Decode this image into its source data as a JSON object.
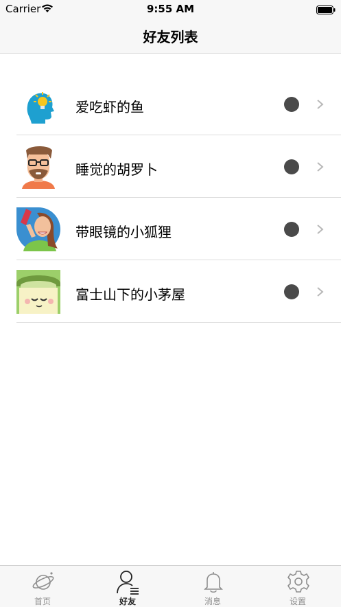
{
  "status_bar": {
    "carrier": "Carrier",
    "time": "9:55 AM"
  },
  "nav": {
    "title": "好友列表"
  },
  "friends": [
    {
      "name": "爱吃虾的鱼",
      "avatar": "lightbulb-head-avatar",
      "status_color": "#4a4a4a"
    },
    {
      "name": "睡觉的胡罗卜",
      "avatar": "bearded-man-avatar",
      "status_color": "#4a4a4a"
    },
    {
      "name": "带眼镜的小狐狸",
      "avatar": "selfie-woman-avatar",
      "status_color": "#4a4a4a"
    },
    {
      "name": "富士山下的小茅屋",
      "avatar": "capped-boy-avatar",
      "status_color": "#4a4a4a"
    }
  ],
  "tabs": [
    {
      "label": "首页",
      "icon": "planet-icon",
      "active": false
    },
    {
      "label": "好友",
      "icon": "user-list-icon",
      "active": true
    },
    {
      "label": "消息",
      "icon": "bell-icon",
      "active": false
    },
    {
      "label": "设置",
      "icon": "gear-icon",
      "active": false
    }
  ]
}
